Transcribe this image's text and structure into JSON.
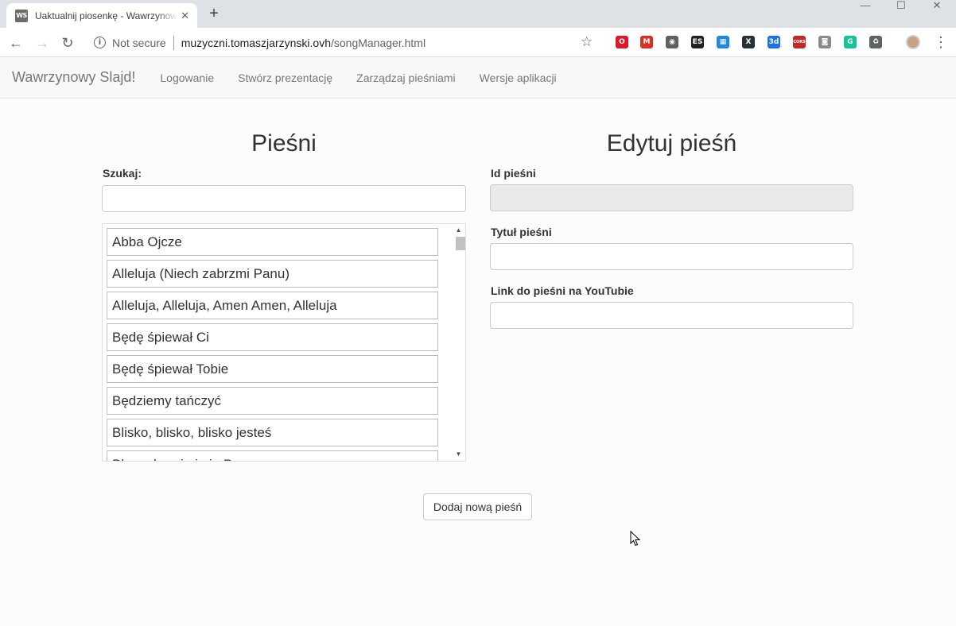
{
  "browser": {
    "tab_title": "Uaktualnij piosenkę - Wawrzynowy Slajd!",
    "tab_favicon_text": "WS",
    "tab_close": "✕",
    "new_tab": "+",
    "security_label": "Not secure",
    "url_host": "muzyczni.tomaszjarzynski.ovh",
    "url_path": "/songManager.html",
    "window_controls": {
      "minimize": "—",
      "maximize": "☐",
      "close": "✕"
    },
    "extensions": [
      {
        "name": "opera-icon",
        "color": "#e0162b",
        "glyph": "O"
      },
      {
        "name": "gmail-icon",
        "color": "#d93025",
        "glyph": "M"
      },
      {
        "name": "film-reel-icon",
        "color": "#606060",
        "glyph": "◉"
      },
      {
        "name": "es-extension-icon",
        "color": "#202124",
        "glyph": "ES"
      },
      {
        "name": "screenshot-extension-icon",
        "color": "#1e88e5",
        "glyph": "▦"
      },
      {
        "name": "x-extension-icon",
        "color": "#263238",
        "glyph": "X"
      },
      {
        "name": "3d-extension-icon",
        "color": "#1a73e8",
        "glyph": "3d"
      },
      {
        "name": "cors-extension-icon",
        "color": "#c62828",
        "glyph": "CORS"
      },
      {
        "name": "camera-icon",
        "color": "#8a8a8a",
        "glyph": "◙"
      },
      {
        "name": "grammarly-icon",
        "color": "#15c39a",
        "glyph": "G"
      },
      {
        "name": "recycle-icon",
        "color": "#5f6368",
        "glyph": "♻"
      }
    ]
  },
  "navbar": {
    "brand": "Wawrzynowy Slajd!",
    "links": [
      "Logowanie",
      "Stwórz prezentację",
      "Zarządzaj pieśniami",
      "Wersje aplikacji"
    ]
  },
  "songs_panel": {
    "title": "Pieśni",
    "search_label": "Szukaj:",
    "search_value": "",
    "songs": [
      "Abba Ojcze",
      "Alleluja (Niech zabrzmi Panu)",
      "Alleluja, Alleluja, Amen Amen, Alleluja",
      "Będę śpiewał Ci",
      "Będę śpiewał Tobie",
      "Będziemy tańczyć",
      "Blisko, blisko, blisko jesteś",
      "Błogosławcie imię Pana"
    ]
  },
  "edit_panel": {
    "title": "Edytuj pieśń",
    "id_label": "Id pieśni",
    "id_value": "",
    "title_label": "Tytuł pieśni",
    "title_value": "",
    "youtube_label": "Link do pieśni na YouTubie",
    "youtube_value": ""
  },
  "add_button": "Dodaj nową pieśń"
}
